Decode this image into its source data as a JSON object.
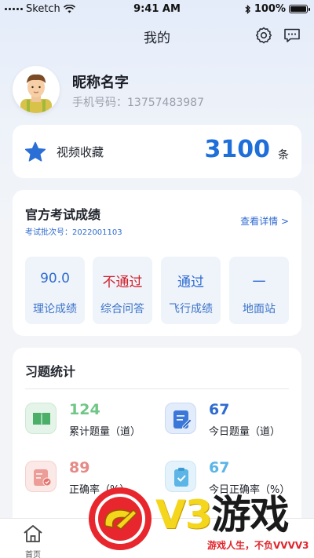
{
  "status_bar": {
    "carrier": "Sketch",
    "time": "9:41 AM",
    "battery": "100%"
  },
  "header": {
    "title": "我的",
    "icons": [
      "settings-icon",
      "message-icon"
    ]
  },
  "profile": {
    "nickname": "昵称名字",
    "phone": "手机号码：13757483987"
  },
  "favorites": {
    "label": "视频收藏",
    "count": "3100",
    "unit": "条",
    "accent": "#1e6fd9"
  },
  "exam": {
    "title": "官方考试成绩",
    "batch": "考试批次号：2022001103",
    "detail_link": "查看详情 >",
    "scores": [
      {
        "value": "90.0",
        "label": "理论成绩",
        "color": "#2f6bd0"
      },
      {
        "value": "不通过",
        "label": "综合问答",
        "color": "#d0202a"
      },
      {
        "value": "通过",
        "label": "飞行成绩",
        "color": "#2f6bd0"
      },
      {
        "value": "一",
        "label": "地面站",
        "color": "#2f6bd0"
      }
    ]
  },
  "stats": {
    "title": "习题统计",
    "items": [
      {
        "value": "124",
        "label": "累计题量（道）",
        "color": "#6fc686",
        "icon": "book-icon"
      },
      {
        "value": "67",
        "label": "今日题量（道）",
        "color": "#2f6bd0",
        "icon": "edit-document-icon"
      },
      {
        "value": "89",
        "label": "正确率（%）",
        "color": "#e58a86",
        "icon": "document-check-icon"
      },
      {
        "value": "67",
        "label": "今日正确率（%）",
        "color": "#5bb5e6",
        "icon": "clipboard-check-icon"
      }
    ]
  },
  "tab_bar": {
    "home_label": "首页"
  },
  "watermark": {
    "brand": "V3",
    "brand_cn": "游戏",
    "slogan": "游戏人生，不负VVVV3"
  }
}
